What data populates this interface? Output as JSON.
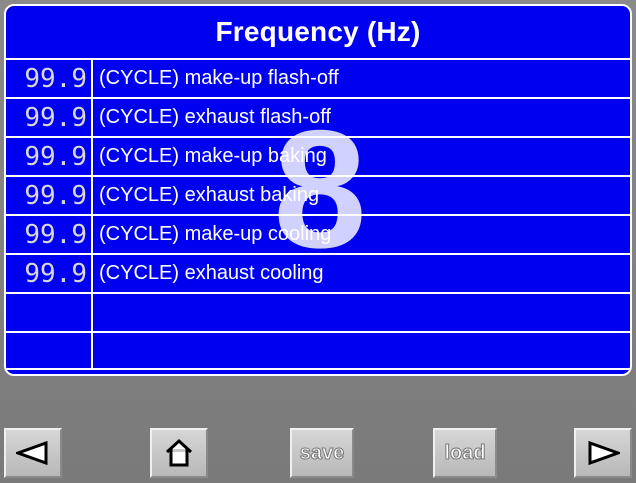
{
  "panel": {
    "title": "Frequency (Hz)",
    "rows": [
      {
        "value": "99.9",
        "label": "(CYCLE) make-up flash-off"
      },
      {
        "value": "99.9",
        "label": "(CYCLE) exhaust flash-off"
      },
      {
        "value": "99.9",
        "label": "(CYCLE) make-up baking"
      },
      {
        "value": "99.9",
        "label": "(CYCLE) exhaust baking"
      },
      {
        "value": "99.9",
        "label": "(CYCLE) make-up cooling"
      },
      {
        "value": "99.9",
        "label": "(CYCLE) exhaust cooling"
      },
      {
        "value": "",
        "label": ""
      },
      {
        "value": "",
        "label": ""
      }
    ],
    "overlay_number": "8"
  },
  "toolbar": {
    "left_icon": "left-arrow-icon",
    "home_icon": "home-icon",
    "save_label": "save",
    "load_label": "load",
    "right_icon": "right-arrow-icon"
  },
  "colors": {
    "panel_blue": "#0000f0",
    "border_white": "#ffffff",
    "background_gray": "#808080"
  }
}
